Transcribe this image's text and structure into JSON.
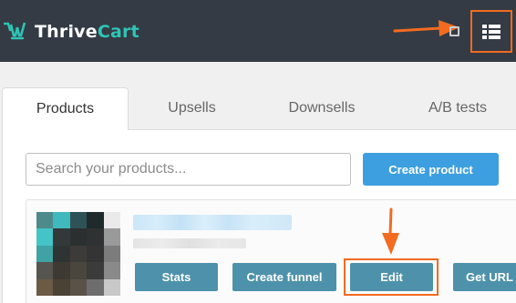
{
  "header": {
    "brand_name_1": "Thrive",
    "brand_name_2": "Cart",
    "brand_color": "#2ec4b6",
    "background": "#343b44",
    "menu_icon": "grid-list-icon",
    "annotation_color": "#f26b21"
  },
  "tabs": [
    {
      "label": "Products",
      "active": true
    },
    {
      "label": "Upsells",
      "active": false
    },
    {
      "label": "Downsells",
      "active": false
    },
    {
      "label": "A/B tests",
      "active": false
    }
  ],
  "search": {
    "placeholder": "Search your products...",
    "value": ""
  },
  "create_button": {
    "label": "Create product",
    "color": "#3d9fe0"
  },
  "product_actions": {
    "stats": "Stats",
    "create_funnel": "Create funnel",
    "edit": "Edit",
    "get_url": "Get URL",
    "color": "#4d92aa"
  }
}
